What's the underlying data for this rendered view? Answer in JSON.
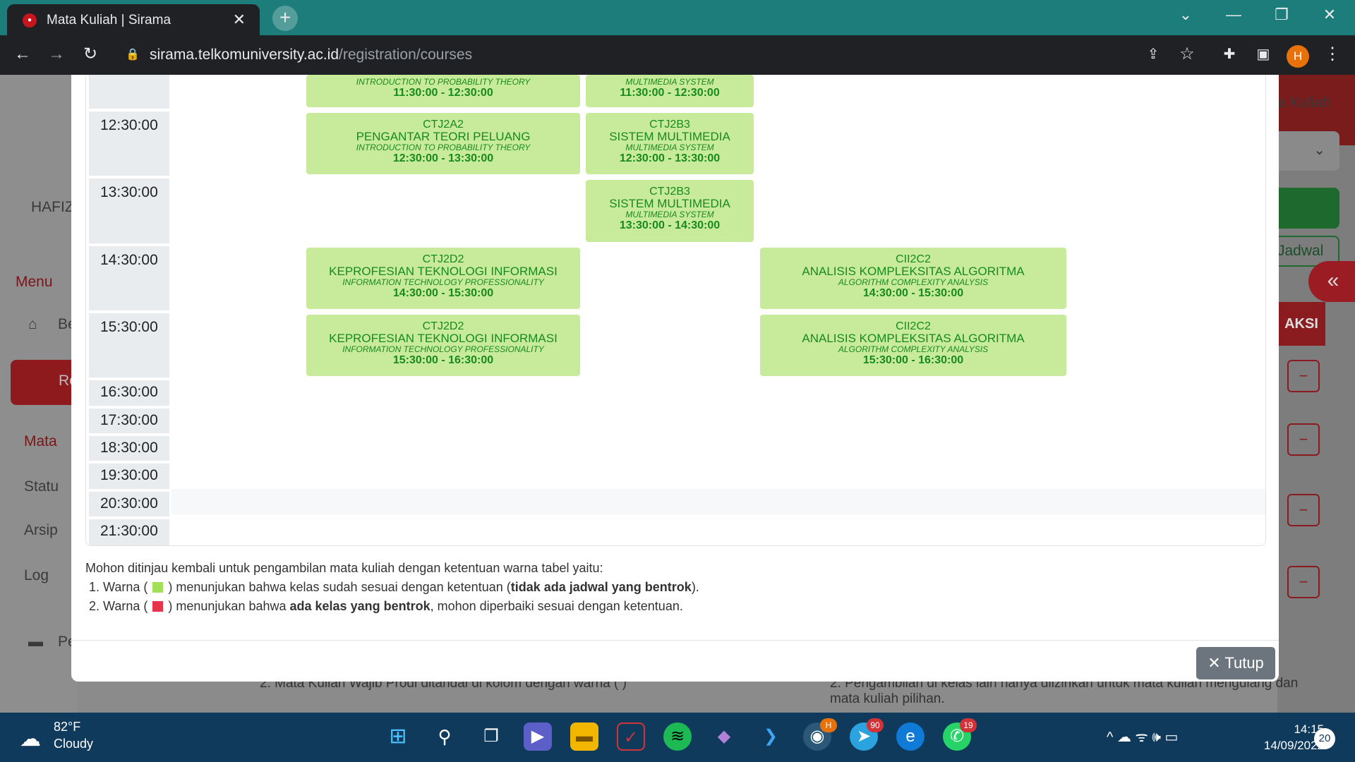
{
  "browser": {
    "tab_title": "Mata Kuliah | Sirama",
    "tab_close": "✕",
    "new_tab": "+",
    "url_host": "sirama.telkomuniversity.ac.id",
    "url_path": "/registration/courses",
    "profile_initial": "H",
    "win_min": "—",
    "win_restore": "❐",
    "win_close": "✕",
    "win_chevron": "⌄"
  },
  "background_page": {
    "user_fragment": "HAFIZ",
    "menu_label": "Menu",
    "side_items": [
      "Be",
      "Re",
      "Mata",
      "Statu",
      "Arsip",
      "Log",
      "Pe"
    ],
    "right_title": "a Kuliah",
    "right_jadwal": "Jadwal",
    "right_aksi": "AKSI",
    "minus": "−",
    "collapse_icon": "«",
    "note_left": "2. Mata Kuliah Wajib Prodi ditandai di kolom dengan warna (   )",
    "note_right": "2. Pengambilan di kelas lain hanya diizinkan untuk mata kuliah mengulang dan mata kuliah pilihan."
  },
  "schedule": {
    "times": [
      "12:30:00",
      "13:30:00",
      "14:30:00",
      "15:30:00",
      "16:30:00",
      "17:30:00",
      "18:30:00",
      "19:30:00",
      "20:30:00",
      "21:30:00"
    ],
    "courses": [
      {
        "code": "",
        "name": "",
        "en": "INTRODUCTION TO PROBABILITY THEORY",
        "time": "11:30:00 - 12:30:00"
      },
      {
        "code": "",
        "name": "",
        "en": "MULTIMEDIA SYSTEM",
        "time": "11:30:00 - 12:30:00"
      },
      {
        "code": "CTJ2A2",
        "name": "PENGANTAR TEORI PELUANG",
        "en": "INTRODUCTION TO PROBABILITY THEORY",
        "time": "12:30:00 - 13:30:00"
      },
      {
        "code": "CTJ2B3",
        "name": "SISTEM MULTIMEDIA",
        "en": "MULTIMEDIA SYSTEM",
        "time": "12:30:00 - 13:30:00"
      },
      {
        "code": "CTJ2B3",
        "name": "SISTEM MULTIMEDIA",
        "en": "MULTIMEDIA SYSTEM",
        "time": "13:30:00 - 14:30:00"
      },
      {
        "code": "CTJ2D2",
        "name": "KEPROFESIAN TEKNOLOGI INFORMASI",
        "en": "INFORMATION TECHNOLOGY PROFESSIONALITY",
        "time": "14:30:00 - 15:30:00"
      },
      {
        "code": "CII2C2",
        "name": "ANALISIS KOMPLEKSITAS ALGORITMA",
        "en": "ALGORITHM COMPLEXITY ANALYSIS",
        "time": "14:30:00 - 15:30:00"
      },
      {
        "code": "CTJ2D2",
        "name": "KEPROFESIAN TEKNOLOGI INFORMASI",
        "en": "INFORMATION TECHNOLOGY PROFESSIONALITY",
        "time": "15:30:00 - 16:30:00"
      },
      {
        "code": "CII2C2",
        "name": "ANALISIS KOMPLEKSITAS ALGORITMA",
        "en": "ALGORITHM COMPLEXITY ANALYSIS",
        "time": "15:30:00 - 16:30:00"
      }
    ]
  },
  "legend": {
    "intro": "Mohon ditinjau kembali untuk pengambilan mata kuliah dengan ketentuan warna tabel yaitu:",
    "item1_prefix": "1. Warna (",
    "item1_mid": ") menunjukan bahwa kelas sudah sesuai dengan ketentuan (",
    "item1_bold": "tidak ada jadwal yang bentrok",
    "item1_suffix": ").",
    "item2_prefix": "2. Warna (",
    "item2_mid": ") menunjukan bahwa ",
    "item2_bold": "ada kelas yang bentrok",
    "item2_suffix": ", mohon diperbaiki sesuai dengan ketentuan.",
    "green": "#a3e05a",
    "red": "#e8334a"
  },
  "close_button": "✕ Tutup",
  "taskbar": {
    "temp": "82°F",
    "condition": "Cloudy",
    "time": "14:15",
    "date": "14/09/2022",
    "notif_count": "20",
    "telegram_badge": "90",
    "whatsapp_badge": "19",
    "chrome_badge": "H",
    "tray": "^  ☁  ᯤ  🕪  ▭"
  },
  "colors": {
    "course_bg": "#c7eb9a",
    "course_text": "#188a1c",
    "time_bg": "#e9ecef",
    "close_btn": "#6c757d",
    "tab_strip": "#1c7d7a"
  }
}
